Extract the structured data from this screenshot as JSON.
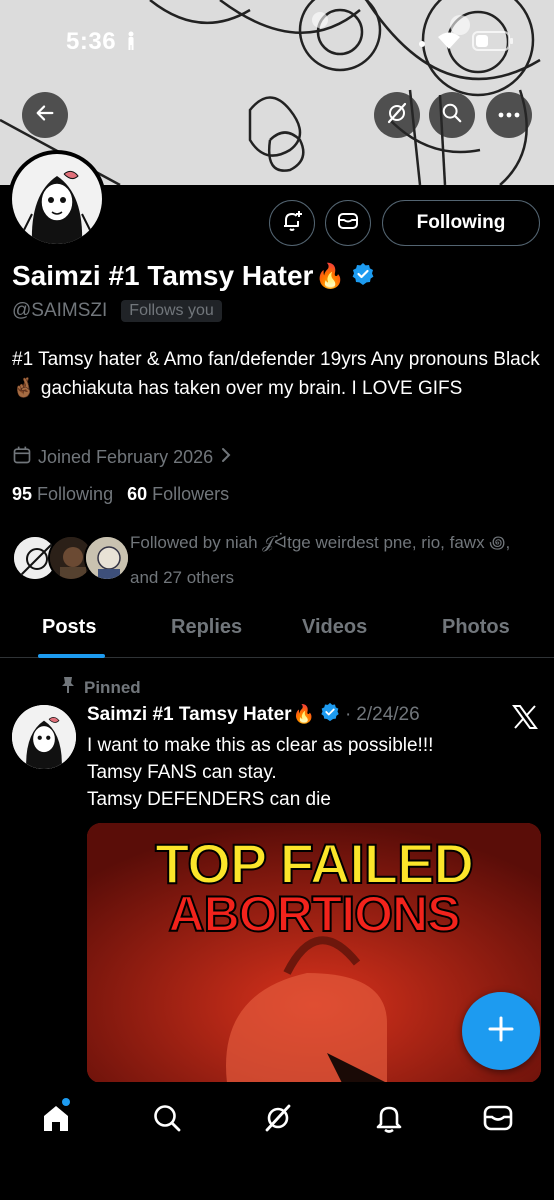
{
  "status_bar": {
    "time": "5:36"
  },
  "profile": {
    "display_name": "Saimzi #1 Tamsy Hater",
    "name_emoji": "🔥",
    "handle": "@SAIMSZI",
    "follows_you": "Follows you",
    "bio": "#1 Tamsy hater & Amo fan/defender 19yrs Any pronouns Black 🤞🏾 gachiakuta has taken over my brain. I LOVE GIFS",
    "joined": "Joined February 2026",
    "following_count": "95",
    "following_label": "Following",
    "followers_count": "60",
    "followers_label": "Followers",
    "followed_by": "Followed by niah 𝒥ᐛtge weirdest pne, rio, fawx ꩜, and 27 others",
    "following_button": "Following"
  },
  "tabs": [
    {
      "label": "Posts",
      "active": true
    },
    {
      "label": "Replies",
      "active": false
    },
    {
      "label": "Videos",
      "active": false
    },
    {
      "label": "Photos",
      "active": false
    }
  ],
  "post": {
    "pinned_label": "Pinned",
    "author_name": "Saimzi #1 Tamsy Hater",
    "author_emoji": "🔥",
    "separator": "·",
    "date": "2/24/26",
    "text": "I want to make this as clear as possible!!!\nTamsy FANS can stay.\nTamsy DEFENDERS can die",
    "media_line1": "TOP FAILED",
    "media_line2": "ABORTIONS"
  },
  "colors": {
    "accent": "#1d9bf0",
    "background": "#000000",
    "secondary_text": "#71767b",
    "media_yellow": "#fbe52a",
    "media_red": "#f2231c"
  },
  "icons": [
    "back-arrow-icon",
    "grok-icon",
    "search-icon",
    "more-icon",
    "notification-bell-plus-icon",
    "message-icon",
    "verified-badge-icon",
    "calendar-icon",
    "chevron-right-icon",
    "pin-icon",
    "x-logo-icon",
    "plus-icon",
    "home-icon",
    "explore-icon",
    "grok-nav-icon",
    "notifications-icon",
    "messages-icon"
  ]
}
